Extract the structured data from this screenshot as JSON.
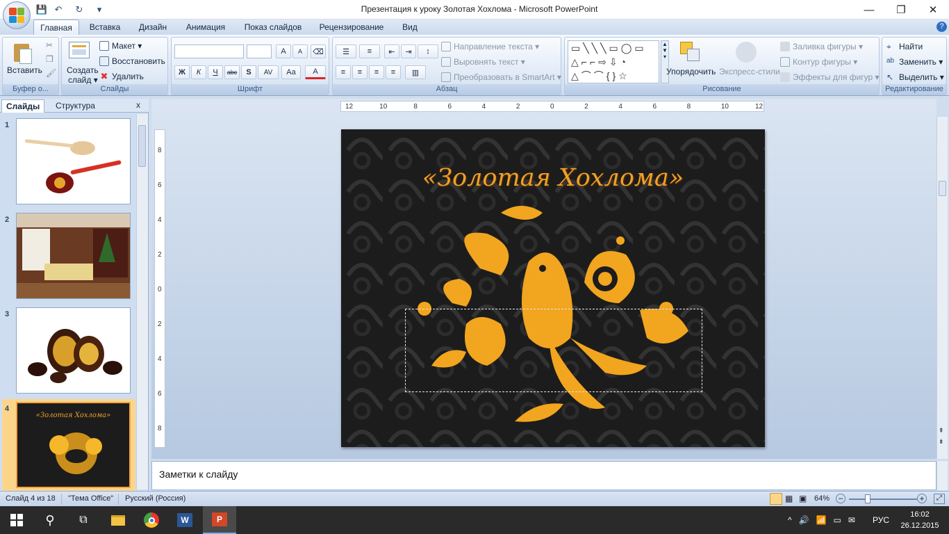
{
  "window": {
    "title": "Презентация к уроку Золотая Хохлома - Microsoft PowerPoint",
    "minimize": "—",
    "maximize": "❐",
    "close": "✕"
  },
  "qat": {
    "save": "💾",
    "undo": "↶",
    "redo": "↻",
    "customize": "▾"
  },
  "tabs": [
    "Главная",
    "Вставка",
    "Дизайн",
    "Анимация",
    "Показ слайдов",
    "Рецензирование",
    "Вид"
  ],
  "help": "?",
  "ribbon": {
    "clipboard": {
      "label": "Буфер о...",
      "paste": "Вставить"
    },
    "slides": {
      "label": "Слайды",
      "new_slide": "Создать",
      "new_slide2": "слайд ▾",
      "layout": "Макет ▾",
      "reset": "Восстановить",
      "delete": "Удалить"
    },
    "font": {
      "label": "Шрифт",
      "bold": "Ж",
      "italic": "К",
      "underline": "Ч",
      "strike": "abc",
      "shadow": "S",
      "spacing": "AV",
      "case": "Aa",
      "color": "A",
      "grow": "A",
      "shrink": "A"
    },
    "paragraph": {
      "label": "Абзац",
      "direction": "Направление текста ▾",
      "align": "Выровнять текст ▾",
      "smartart": "Преобразовать в SmartArt ▾"
    },
    "drawing": {
      "label": "Рисование",
      "arrange": "Упорядочить",
      "quickstyles": "Экспресс-стили",
      "fill": "Заливка фигуры ▾",
      "outline": "Контур фигуры ▾",
      "effects": "Эффекты для фигур ▾"
    },
    "editing": {
      "label": "Редактирование",
      "find": "Найти",
      "replace": "Заменить ▾",
      "select": "Выделить ▾"
    }
  },
  "pane": {
    "tab_slides": "Слайды",
    "tab_outline": "Структура",
    "close": "x"
  },
  "thumbnails": [
    {
      "num": "1"
    },
    {
      "num": "2"
    },
    {
      "num": "3"
    },
    {
      "num": "4",
      "title": "«Золотая Хохлома»"
    }
  ],
  "rulers": {
    "h_ticks": [
      "12",
      "10",
      "8",
      "6",
      "4",
      "2",
      "0",
      "2",
      "4",
      "6",
      "8",
      "10",
      "12"
    ],
    "v_ticks": [
      "8",
      "6",
      "4",
      "2",
      "0",
      "2",
      "4",
      "6",
      "8"
    ]
  },
  "slide": {
    "title": "«Золотая Хохлома»"
  },
  "notes": {
    "placeholder": "Заметки к слайду"
  },
  "status": {
    "slide": "Слайд 4 из 18",
    "theme": "\"Тема Office\"",
    "language": "Русский (Россия)",
    "zoom": "64%"
  },
  "taskbar": {
    "lang": "РУС",
    "time": "16:02",
    "date": "26.12.2015"
  },
  "colors": {
    "accent": "#f0a02a",
    "ribbon": "#dde8f6",
    "slide_bg": "#1c1c1c"
  }
}
